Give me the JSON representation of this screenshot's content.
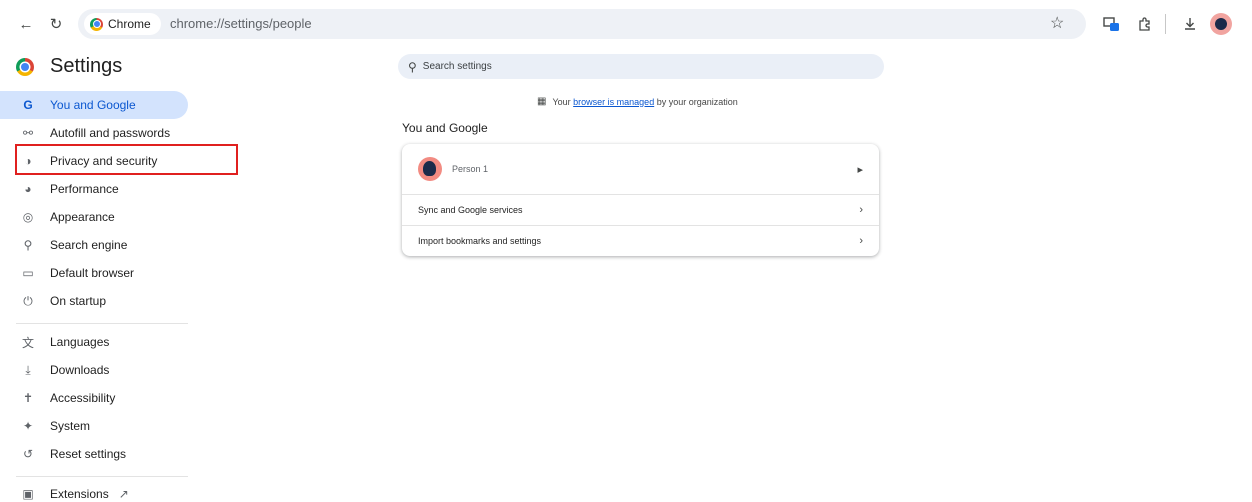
{
  "toolbar": {
    "back_icon": "arrow-left-icon",
    "reload_icon": "reload-icon",
    "chip_label": "Chrome",
    "url": "chrome://settings/people",
    "bookmark_icon": "star-icon",
    "cast_icon": "tab-search-icon",
    "extensions_icon": "puzzle-icon",
    "download_icon": "download-icon",
    "profile_icon": "profile-avatar-icon"
  },
  "sidebar": {
    "title": "Settings",
    "items": [
      {
        "label": "You and Google",
        "icon": "G"
      },
      {
        "label": "Autofill and passwords",
        "icon": "key-icon"
      },
      {
        "label": "Privacy and security",
        "icon": "shield-icon"
      },
      {
        "label": "Performance",
        "icon": "speedometer-icon"
      },
      {
        "label": "Appearance",
        "icon": "palette-icon"
      },
      {
        "label": "Search engine",
        "icon": "search-icon"
      },
      {
        "label": "Default browser",
        "icon": "browser-window-icon"
      },
      {
        "label": "On startup",
        "icon": "power-icon"
      },
      {
        "label": "Languages",
        "icon": "translate-icon"
      },
      {
        "label": "Downloads",
        "icon": "download-icon"
      },
      {
        "label": "Accessibility",
        "icon": "accessibility-icon"
      },
      {
        "label": "System",
        "icon": "wrench-icon"
      },
      {
        "label": "Reset settings",
        "icon": "reset-icon"
      },
      {
        "label": "Extensions",
        "icon": "puzzle-icon"
      }
    ],
    "active_index": 0,
    "highlighted_index": 2
  },
  "main": {
    "search_placeholder": "Search settings",
    "managed_prefix": "Your",
    "managed_link": "browser is managed",
    "managed_suffix": "by your organization",
    "section_title": "You and Google",
    "rows": [
      {
        "label": "Person 1"
      },
      {
        "label": "Sync and Google services"
      },
      {
        "label": "Import bookmarks and settings"
      }
    ]
  },
  "colors": {
    "accent": "#0b57d0",
    "active_bg": "#d3e3fd",
    "highlight_border": "#e0201f"
  }
}
